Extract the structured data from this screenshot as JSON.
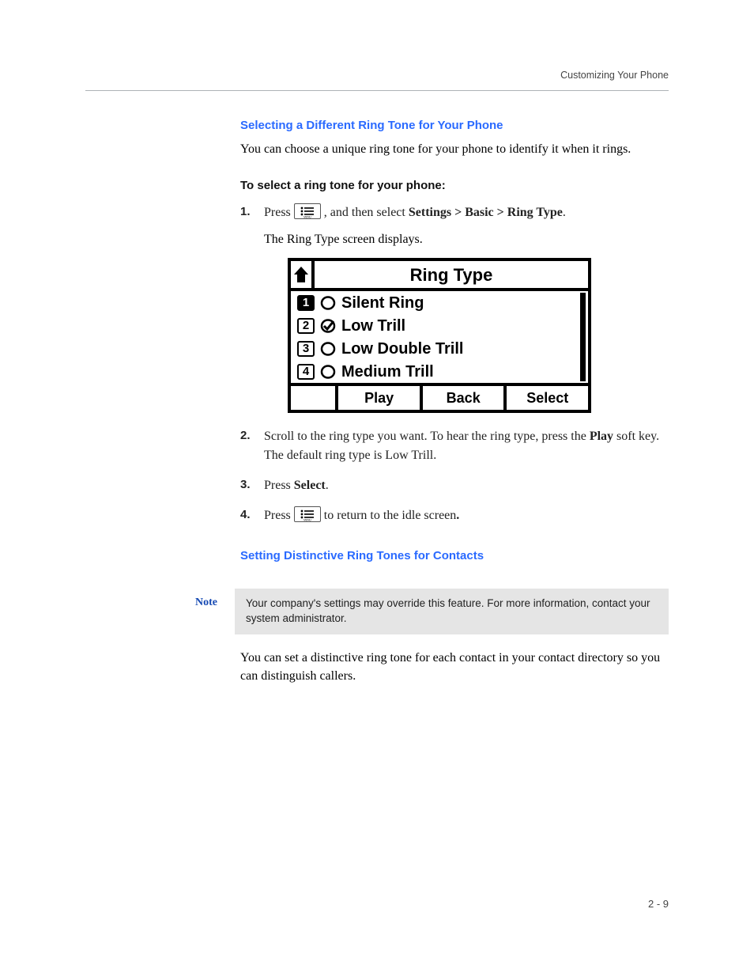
{
  "running_head": "Customizing Your Phone",
  "section1": {
    "title": "Selecting a Different Ring Tone for Your Phone",
    "intro": "You can choose a unique ring tone for your phone to identify it when it rings.",
    "sub": "To select a ring tone for your phone:",
    "step1_num": "1.",
    "step1_a": "Press ",
    "step1_b": " , and then select ",
    "step1_c": "Settings > Basic > Ring Type",
    "step1_d": ".",
    "step1_follow": "The Ring Type screen displays.",
    "step2_num": "2.",
    "step2_a": "Scroll to the ring type you want. To hear the ring type, press the ",
    "step2_b": "Play",
    "step2_c": " soft key. The default ring type is Low Trill.",
    "step3_num": "3.",
    "step3_a": "Press ",
    "step3_b": "Select",
    "step3_c": ".",
    "step4_num": "4.",
    "step4_a": "Press ",
    "step4_b": " to return to the idle screen",
    "step4_c": "."
  },
  "lcd": {
    "title": "Ring Type",
    "items": [
      {
        "n": "1",
        "label": "Silent Ring",
        "checked": false,
        "inv": true
      },
      {
        "n": "2",
        "label": "Low Trill",
        "checked": true,
        "inv": false
      },
      {
        "n": "3",
        "label": "Low Double Trill",
        "checked": false,
        "inv": false
      },
      {
        "n": "4",
        "label": "Medium Trill",
        "checked": false,
        "inv": false
      }
    ],
    "soft": [
      "Play",
      "Back",
      "Select"
    ]
  },
  "section2": {
    "title": "Setting Distinctive Ring Tones for Contacts",
    "note_label": "Note",
    "note_body": "Your company's settings may override this feature. For more information, contact your system administrator.",
    "body": "You can set a distinctive ring tone for each contact in your contact directory so you can distinguish callers."
  },
  "page_number": "2 - 9"
}
